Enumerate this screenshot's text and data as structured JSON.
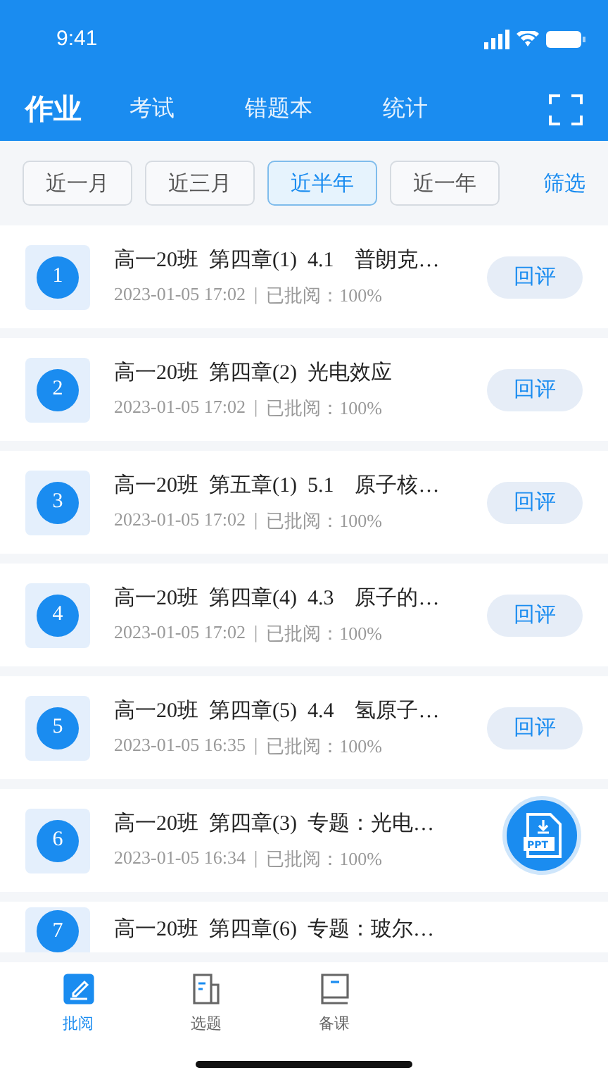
{
  "status_bar": {
    "time": "9:41"
  },
  "header": {
    "tabs": [
      {
        "label": "作业",
        "selected": true
      },
      {
        "label": "考试",
        "selected": false
      },
      {
        "label": "错题本",
        "selected": false
      },
      {
        "label": "统计",
        "selected": false
      }
    ]
  },
  "filters": [
    {
      "label": "近一月",
      "selected": false
    },
    {
      "label": "近三月",
      "selected": false
    },
    {
      "label": "近半年",
      "selected": true
    },
    {
      "label": "近一年",
      "selected": false
    }
  ],
  "filter_link": "筛选",
  "items": [
    {
      "number": "1",
      "title": "高一20班  第四章(1)  4.1　普朗克…",
      "date": "2023-01-05 17:02",
      "separator": "|",
      "status": "已批阅：100%",
      "button": "回评"
    },
    {
      "number": "2",
      "title": "高一20班  第四章(2)  光电效应",
      "date": "2023-01-05 17:02",
      "separator": "|",
      "status": "已批阅：100%",
      "button": "回评"
    },
    {
      "number": "3",
      "title": "高一20班  第五章(1)  5.1　原子核…",
      "date": "2023-01-05 17:02",
      "separator": "|",
      "status": "已批阅：100%",
      "button": "回评"
    },
    {
      "number": "4",
      "title": "高一20班  第四章(4)  4.3　原子的…",
      "date": "2023-01-05 17:02",
      "separator": "|",
      "status": "已批阅：100%",
      "button": "回评"
    },
    {
      "number": "5",
      "title": "高一20班  第四章(5)  4.4　氢原子…",
      "date": "2023-01-05 16:35",
      "separator": "|",
      "status": "已批阅：100%",
      "button": "回评"
    },
    {
      "number": "6",
      "title": "高一20班  第四章(3)  专题：光电…",
      "date": "2023-01-05 16:34",
      "separator": "|",
      "status": "已批阅：100%"
    },
    {
      "number": "7",
      "title": "高一20班  第四章(6)  专题：玻尔…"
    }
  ],
  "fab": {
    "label": "PPT"
  },
  "bottom_tabs": [
    {
      "label": "批阅",
      "selected": true
    },
    {
      "label": "选题",
      "selected": false
    },
    {
      "label": "备课",
      "selected": false
    }
  ]
}
